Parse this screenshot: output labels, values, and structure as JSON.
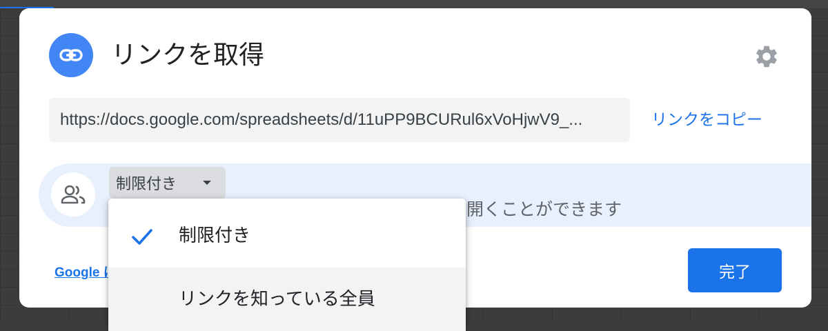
{
  "dialog": {
    "title": "リンクを取得",
    "url": "https://docs.google.com/spreadsheets/d/11uPP9BCURul6xVoHjwV9_...",
    "copy_link_label": "リンクをコピー",
    "access": {
      "selected": "制限付き",
      "description": "開くことができます"
    },
    "footer_link": "Google に",
    "done_label": "完了"
  },
  "access_menu": {
    "items": [
      {
        "label": "制限付き",
        "checked": true
      },
      {
        "label": "リンクを知っている全員",
        "checked": false
      }
    ]
  },
  "colors": {
    "accent": "#1a73e8",
    "link_icon_bg": "#4285f4",
    "access_band": "#e8f0fe"
  },
  "icons": [
    "link-icon",
    "gear-icon",
    "people-icon",
    "checkmark-icon",
    "chevron-down-icon"
  ]
}
